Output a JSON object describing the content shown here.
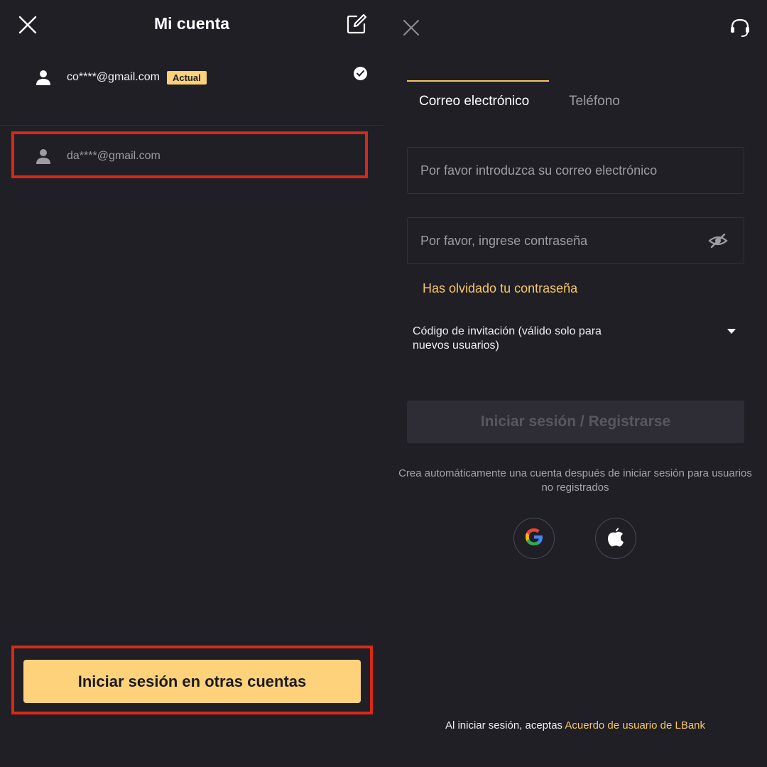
{
  "left": {
    "title": "Mi cuenta",
    "accounts": [
      {
        "email": "co****@gmail.com",
        "badge": "Actual"
      },
      {
        "email": "da****@gmail.com"
      }
    ],
    "other_accounts_button": "Iniciar sesión en otras cuentas"
  },
  "right": {
    "tabs": [
      {
        "label": "Correo electrónico"
      },
      {
        "label": "Teléfono"
      }
    ],
    "email_placeholder": "Por favor introduzca su correo electrónico",
    "password_placeholder": "Por favor, ingrese contraseña",
    "forgot_password": "Has olvidado tu contraseña",
    "invite_label": "Código de invitación (válido solo para nuevos usuarios)",
    "login_button": "Iniciar sesión / Registrarse",
    "auto_create_note": "Crea automáticamente una cuenta después de iniciar sesión para usuarios no registrados",
    "agreement_prefix": "Al iniciar sesión, aceptas",
    "agreement_link": "Acuerdo de usuario de LBank"
  },
  "icons": {
    "close": "close-icon",
    "edit": "edit-icon",
    "user": "user-icon",
    "check": "check-circle-icon",
    "support": "support-headset-icon",
    "eye_off": "eye-off-icon",
    "caret": "caret-down-icon",
    "google": "google-icon",
    "apple": "apple-icon"
  },
  "colors": {
    "background": "#201f26",
    "accent": "#fdd27a",
    "link": "#f6c765",
    "highlight": "#d9281a"
  }
}
